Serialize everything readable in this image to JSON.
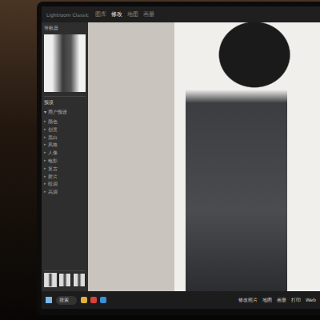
{
  "window": {
    "title": "Lightroom Classic"
  },
  "tabs": [
    {
      "label": "图库",
      "selected": false
    },
    {
      "label": "修改",
      "selected": true
    },
    {
      "label": "地图",
      "selected": false
    },
    {
      "label": "画册",
      "selected": false
    }
  ],
  "sidebar": {
    "title": "导航器",
    "section": "预设",
    "subsection": "▾ 用户预设",
    "items": [
      {
        "icon": "▸",
        "label": "颜色",
        "expanded": false
      },
      {
        "icon": "▸",
        "label": "创意",
        "expanded": false
      },
      {
        "icon": "▸",
        "label": "黑白",
        "expanded": false
      },
      {
        "icon": "▸",
        "label": "风格",
        "expanded": false
      },
      {
        "icon": "▸",
        "label": "人像",
        "expanded": false
      },
      {
        "icon": "▸",
        "label": "电影",
        "expanded": false
      },
      {
        "icon": "▸",
        "label": "复古",
        "expanded": false
      },
      {
        "icon": "▸",
        "label": "胶片",
        "expanded": false
      },
      {
        "icon": "▸",
        "label": "暗调",
        "expanded": false
      },
      {
        "icon": "▸",
        "label": "高调",
        "expanded": false
      }
    ]
  },
  "filmstrip": [
    {
      "selected": true
    },
    {
      "selected": false
    },
    {
      "selected": false
    }
  ],
  "taskbar": {
    "search": "搜索",
    "items": [
      "修改照片",
      "地图",
      "画册",
      "打印",
      "Web"
    ]
  }
}
